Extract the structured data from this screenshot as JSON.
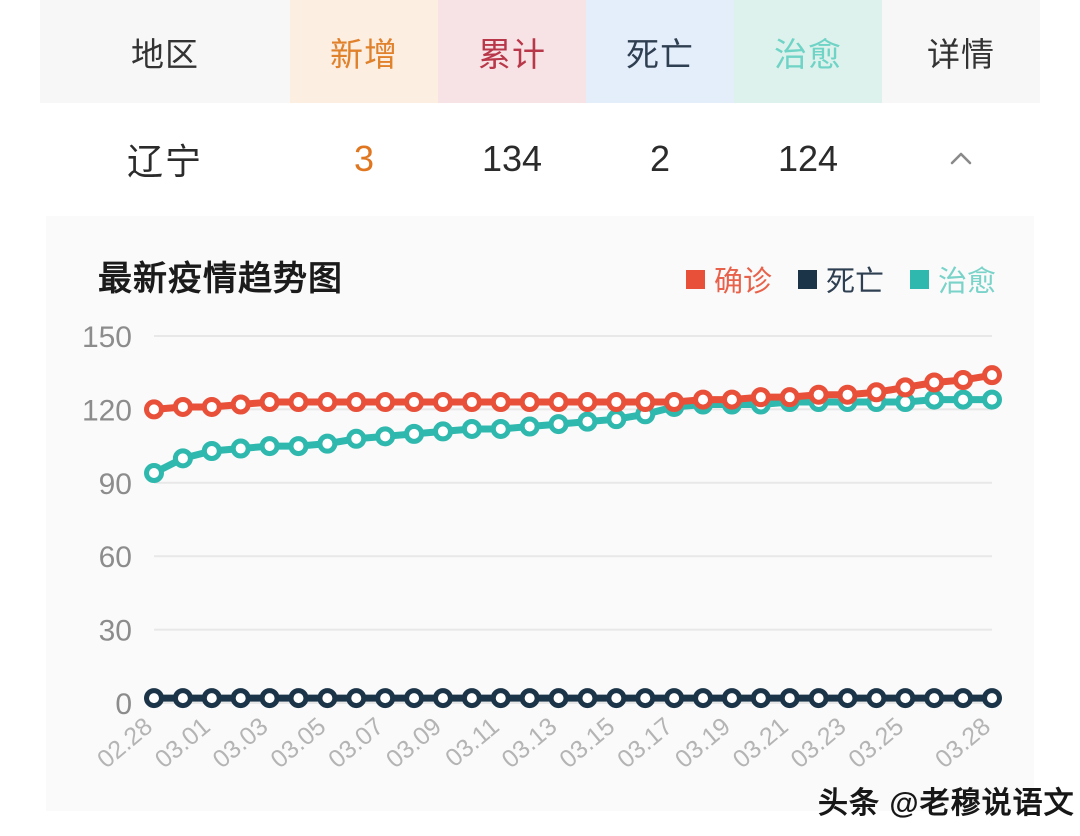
{
  "table": {
    "columns": [
      {
        "key": "region",
        "label": "地区"
      },
      {
        "key": "new",
        "label": "新增"
      },
      {
        "key": "total",
        "label": "累计"
      },
      {
        "key": "death",
        "label": "死亡"
      },
      {
        "key": "cured",
        "label": "治愈"
      },
      {
        "key": "detail",
        "label": "详情"
      }
    ],
    "row": {
      "region": "辽宁",
      "new": "3",
      "total": "134",
      "death": "2",
      "cured": "124",
      "detail_icon": "chevron-up-icon"
    }
  },
  "chart": {
    "title": "最新疫情趋势图",
    "legend": [
      {
        "name": "confirmed",
        "label": "确诊",
        "color": "#e8503a"
      },
      {
        "name": "death",
        "label": "死亡",
        "color": "#1b3448"
      },
      {
        "name": "cured",
        "label": "治愈",
        "color": "#2fb8ad"
      }
    ]
  },
  "watermark": {
    "text": "头条 @老穆说语文"
  },
  "chart_data": {
    "type": "line",
    "title": "最新疫情趋势图",
    "xlabel": "",
    "ylabel": "",
    "ylim": [
      0,
      150
    ],
    "yticks": [
      0,
      30,
      60,
      90,
      120,
      150
    ],
    "grid": true,
    "legend_position": "top-right",
    "x": [
      "02.28",
      "02.29",
      "03.01",
      "03.02",
      "03.03",
      "03.04",
      "03.05",
      "03.06",
      "03.07",
      "03.08",
      "03.09",
      "03.10",
      "03.11",
      "03.12",
      "03.13",
      "03.14",
      "03.15",
      "03.16",
      "03.17",
      "03.18",
      "03.19",
      "03.20",
      "03.21",
      "03.22",
      "03.23",
      "03.24",
      "03.25",
      "03.26",
      "03.27",
      "03.28"
    ],
    "xtick_labels": [
      "02.28",
      "03.01",
      "03.03",
      "03.05",
      "03.07",
      "03.09",
      "03.11",
      "03.13",
      "03.15",
      "03.17",
      "03.19",
      "03.21",
      "03.23",
      "03.25",
      "03.28"
    ],
    "series": [
      {
        "name": "确诊",
        "label": "确诊",
        "color": "#e8503a",
        "values": [
          120,
          121,
          121,
          122,
          123,
          123,
          123,
          123,
          123,
          123,
          123,
          123,
          123,
          123,
          123,
          123,
          123,
          123,
          123,
          124,
          124,
          125,
          125,
          126,
          126,
          127,
          129,
          131,
          132,
          134
        ]
      },
      {
        "name": "死亡",
        "label": "死亡",
        "color": "#1b3448",
        "values": [
          2,
          2,
          2,
          2,
          2,
          2,
          2,
          2,
          2,
          2,
          2,
          2,
          2,
          2,
          2,
          2,
          2,
          2,
          2,
          2,
          2,
          2,
          2,
          2,
          2,
          2,
          2,
          2,
          2,
          2
        ]
      },
      {
        "name": "治愈",
        "label": "治愈",
        "color": "#2fb8ad",
        "values": [
          94,
          100,
          103,
          104,
          105,
          105,
          106,
          108,
          109,
          110,
          111,
          112,
          112,
          113,
          114,
          115,
          116,
          118,
          121,
          122,
          122,
          122,
          123,
          123,
          123,
          123,
          123,
          124,
          124,
          124
        ]
      }
    ]
  }
}
